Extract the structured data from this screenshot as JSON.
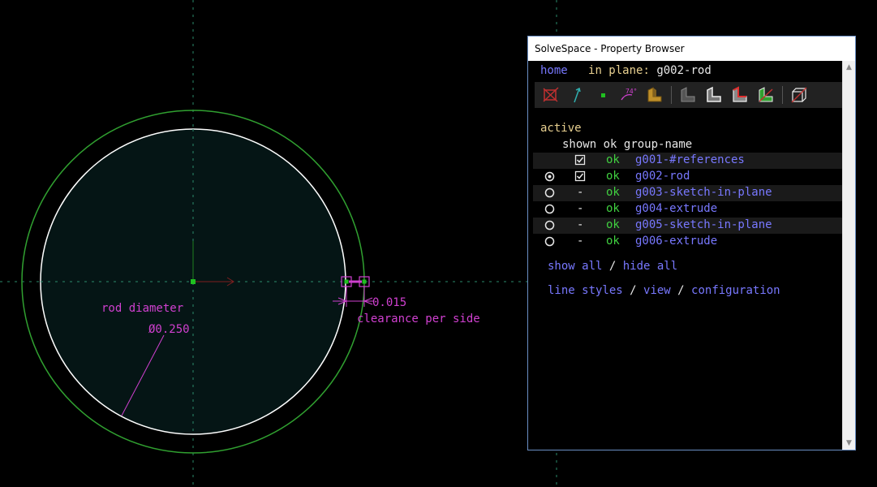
{
  "cad": {
    "rod_label": "rod diameter",
    "diameter_value": "Ø0.250",
    "clearance_value": "0.015",
    "clearance_label": "clearance per side"
  },
  "window": {
    "title": "SolveSpace - Property Browser"
  },
  "nav": {
    "home": "home",
    "in_plane_prefix": "in plane:",
    "in_plane_value": "g002-rod"
  },
  "toolbar": {
    "icons": [
      "workplane-hidden-icon",
      "normal-arrow-icon",
      "point-icon",
      "angle-constraint-icon",
      "shaded-solid-icon",
      "solid-dark-icon",
      "solid-outline-icon",
      "solid-red-edges-icon",
      "solid-green-icon",
      "wireframe-box-icon"
    ],
    "angle_label": "74°"
  },
  "groups": {
    "active_header": "active",
    "col_shown": "shown",
    "col_ok": "ok",
    "col_name": "group-name",
    "rows": [
      {
        "active": false,
        "radio": false,
        "shown": "check",
        "ok": "ok",
        "name": "g001-#references",
        "band": true
      },
      {
        "active": true,
        "radio": true,
        "shown": "check",
        "ok": "ok",
        "name": "g002-rod",
        "band": false
      },
      {
        "active": false,
        "radio": true,
        "shown": "-",
        "ok": "ok",
        "name": "g003-sketch-in-plane",
        "band": true
      },
      {
        "active": false,
        "radio": true,
        "shown": "-",
        "ok": "ok",
        "name": "g004-extrude",
        "band": false
      },
      {
        "active": false,
        "radio": true,
        "shown": "-",
        "ok": "ok",
        "name": "g005-sketch-in-plane",
        "band": true
      },
      {
        "active": false,
        "radio": true,
        "shown": "-",
        "ok": "ok",
        "name": "g006-extrude",
        "band": false
      }
    ]
  },
  "links": {
    "show_all": "show all",
    "slash1": " / ",
    "hide_all": "hide all",
    "line_styles": "line styles",
    "slash2": " / ",
    "view": "view",
    "slash3": " / ",
    "configuration": "configuration"
  },
  "colors": {
    "outer_circle": "#30a030",
    "inner_circle": "#ffffff",
    "fill": "#051515",
    "dimension": "#d040d0",
    "link": "#7878ff",
    "ok": "#40d040"
  }
}
